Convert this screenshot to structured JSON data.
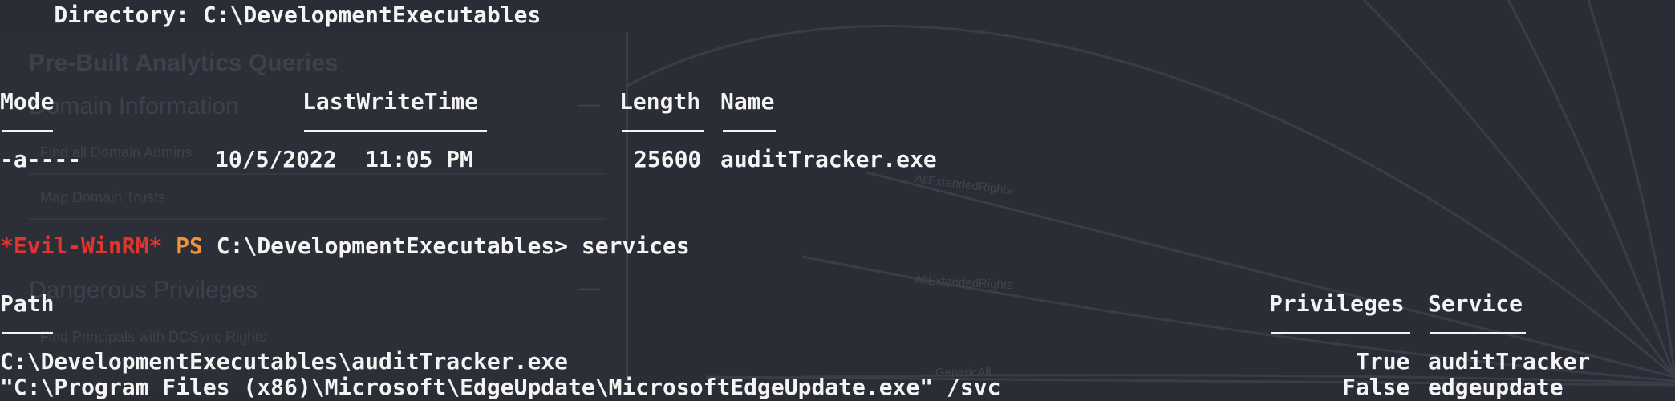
{
  "background": {
    "heading": "Pre-Built Analytics Queries",
    "sections": [
      {
        "label": "Domain Information"
      },
      {
        "label": "Dangerous Privileges"
      }
    ],
    "items": [
      {
        "label": "Find all Domain Admins"
      },
      {
        "label": "Map Domain Trusts"
      },
      {
        "label": "Find Principals with DCSync Rights"
      }
    ],
    "edges": [
      {
        "label": "AllExtendedRights"
      },
      {
        "label": "AllExtendedRights"
      },
      {
        "label": "GenericAll"
      }
    ],
    "collapse_glyph": "—"
  },
  "terminal": {
    "directory_line": "    Directory: C:\\DevelopmentExecutables",
    "dir_headers": {
      "mode": "Mode",
      "lastwrite": "LastWriteTime",
      "length": "Length",
      "name": "Name"
    },
    "dir_rows": [
      {
        "mode": "-a----",
        "date": "10/5/2022",
        "time": "11:05 PM",
        "length": "25600",
        "name": "auditTracker.exe"
      }
    ],
    "prompt": {
      "shell": "*Evil-WinRM*",
      "ps": "PS",
      "cwd": "C:\\DevelopmentExecutables>",
      "command": "services"
    },
    "svc_headers": {
      "path": "Path",
      "privileges": "Privileges",
      "service": "Service"
    },
    "svc_rows": [
      {
        "path": "C:\\DevelopmentExecutables\\auditTracker.exe",
        "privileges": "True",
        "service": "auditTracker"
      },
      {
        "path": "\"C:\\Program Files (x86)\\Microsoft\\EdgeUpdate\\MicrosoftEdgeUpdate.exe\" /svc",
        "privileges": "False",
        "service": "edgeupdate"
      }
    ]
  },
  "colors": {
    "background": "#2b2d36",
    "text": "#f4f4f4",
    "prompt_red": "#e3352f",
    "prompt_orange": "#f0933a"
  }
}
